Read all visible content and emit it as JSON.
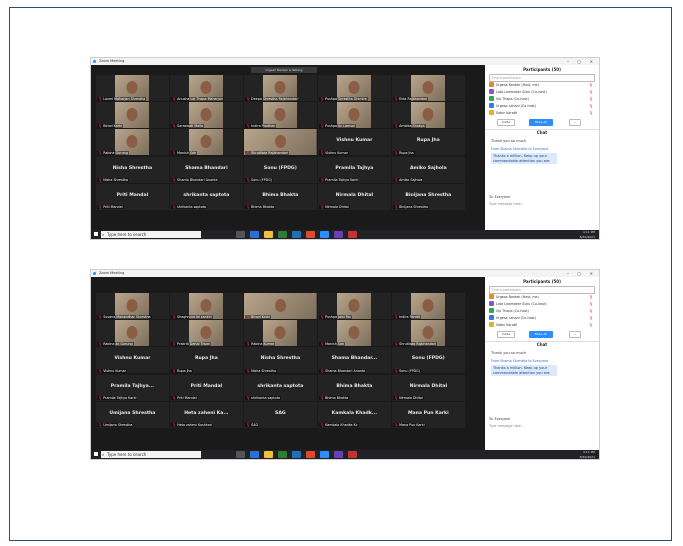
{
  "shot1": {
    "title": "Zoom Meeting",
    "notice": "Urgesh Bardah is Talking",
    "tiles": [
      {
        "name": "Laxmi Maharjan Shrestha",
        "video": true
      },
      {
        "name": "Anusha Lal Thapa Maharjan",
        "video": true
      },
      {
        "name": "Deepa Shrestha Rajbhandari",
        "video": true
      },
      {
        "name": "Pushpa Shrestha Ghimire",
        "video": true
      },
      {
        "name": "Ekta Rajbhandari",
        "video": true
      },
      {
        "name": "Binod Karki",
        "video": true
      },
      {
        "name": "Saraswati Malla",
        "video": true
      },
      {
        "name": "Indira Pradhan",
        "video": true
      },
      {
        "name": "Pushpa Kc Lamsal",
        "video": true
      },
      {
        "name": "Ambika Shakya",
        "video": true
      },
      {
        "name": "Rabina Gurung",
        "video": true
      },
      {
        "name": "Manish Sah",
        "video": true
      },
      {
        "name": "Shrutilata Rajbhandari",
        "video": true,
        "wide": true
      },
      {
        "name": "Vishnu Kumar",
        "video": false,
        "label": "Vishnu Kumar"
      },
      {
        "name": "Rupa Jha",
        "video": false,
        "label": "Rupa Jha"
      },
      {
        "name": "Nisha Shrestha",
        "video": false,
        "label": "Nisha Shrestha"
      },
      {
        "name": "Shanta Bhandari Ananta",
        "video": false,
        "label": "Shama Bhandari"
      },
      {
        "name": "Sonu (FPDG)",
        "video": false,
        "label": "Sonu (FPDG)"
      },
      {
        "name": "Pramila Tajhya Karki",
        "video": false,
        "label": "Pramila Tajhya"
      },
      {
        "name": "Amiko Sajhola",
        "video": false,
        "label": "Amiko Sajhola"
      },
      {
        "name": "Priti Mandal",
        "video": false,
        "label": "Priti Mandal"
      },
      {
        "name": "shrikanta saptota",
        "video": false,
        "label": "shrikanta saptota"
      },
      {
        "name": "Bhima Bhakta",
        "video": false,
        "label": "Bhima Bhakta"
      },
      {
        "name": "Nirmala Dhital",
        "video": false,
        "label": "Nirmala Dhital"
      },
      {
        "name": "Binijana Shrestha",
        "video": false,
        "label": "Binijana Shrestha"
      }
    ],
    "participants_title": "Participants (50)",
    "search_placeholder": "Find a participant",
    "participants": [
      {
        "name": "Urgesa Bardah (Host, me)",
        "color": "#e58a2b"
      },
      {
        "name": "Lata Lawmaker Suku (Co-host)",
        "color": "#8a57c7"
      },
      {
        "name": "Vip Thapa (Co-host)",
        "color": "#2fa84f"
      },
      {
        "name": "Urgesa Lahani (Co-host)",
        "color": "#3b7be0"
      },
      {
        "name": "Sabin Karatti",
        "color": "#e0b02f"
      }
    ],
    "btn_invite": "Invite",
    "btn_mute_all": "Mute All",
    "btn_more": "...",
    "chat_title": "Chat",
    "chat_msg": "Thank you so much",
    "chat_from": "From Shama Shrestha to Everyone",
    "chat_bubble": "Thanks a million. Keep up your commendable attention you are.",
    "chat_to": "To: Everyone",
    "chat_placeholder": "Type message here...",
    "search_text": "Type here to search",
    "tray_time": "4:11 PM",
    "tray_date": "8/30/2021"
  },
  "shot2": {
    "title": "Zoom Meeting",
    "tiles": [
      {
        "name": "Susana Manandhar Shrestha",
        "video": true
      },
      {
        "name": "Shaghruva lal sankhi",
        "video": true
      },
      {
        "name": "Binod Karki",
        "video": true,
        "wide": true
      },
      {
        "name": "Pushpa Jaisi Rai",
        "video": true
      },
      {
        "name": "Indira Pandit",
        "video": true
      },
      {
        "name": "Rabina kc Gurung",
        "video": true
      },
      {
        "name": "Prakriti Dahal Tiwari",
        "video": true
      },
      {
        "name": "Rabina Kumar",
        "video": true
      },
      {
        "name": "Manish Sah",
        "video": true
      },
      {
        "name": "Shrutilata Rajbhandari",
        "video": true
      },
      {
        "name": "Vishnu Kumar",
        "video": false,
        "label": "Vishnu Kumar"
      },
      {
        "name": "Rupa Jha",
        "video": false,
        "label": "Rupa Jha"
      },
      {
        "name": "Nisha Shrestha",
        "video": false,
        "label": "Nisha Shrestha"
      },
      {
        "name": "Shama Bhandari Ananta",
        "video": false,
        "label": "Shama Bhandar..."
      },
      {
        "name": "Sonu (FPDG)",
        "video": false,
        "label": "Sonu (FPDG)"
      },
      {
        "name": "Pramila Tajhya Karki",
        "video": false,
        "label": "Pramila Tajhya..."
      },
      {
        "name": "Priti Mandal",
        "video": false,
        "label": "Priti Mandal"
      },
      {
        "name": "shrikanta saptota",
        "video": false,
        "label": "shrikanta saptota"
      },
      {
        "name": "Bhima Bhakta",
        "video": false,
        "label": "Bhima Bhakta"
      },
      {
        "name": "Nirmala Dhital",
        "video": false,
        "label": "Nirmala Dhital"
      },
      {
        "name": "Umijana Shrestha",
        "video": false,
        "label": "Umijana Shrestha"
      },
      {
        "name": "Heta zaheni Kushkari",
        "video": false,
        "label": "Heta zaheni Ka..."
      },
      {
        "name": "SAG",
        "video": false,
        "label": "SAG"
      },
      {
        "name": "Kamkala Khadka Kc",
        "video": false,
        "label": "Kamkala Khadk..."
      },
      {
        "name": "Mana Pun Karki",
        "video": false,
        "label": "Mana Pun Karki"
      }
    ],
    "participants_title": "Participants (50)",
    "search_placeholder": "Find a participant",
    "participants": [
      {
        "name": "Urgesa Bardah (Host, me)",
        "color": "#e58a2b"
      },
      {
        "name": "Lata Lawmaker Suku (Co-host)",
        "color": "#8a57c7"
      },
      {
        "name": "Vip Thapa (Co-host)",
        "color": "#2fa84f"
      },
      {
        "name": "Urgesa Lahani (Co-host)",
        "color": "#3b7be0"
      },
      {
        "name": "Sabin Karatti",
        "color": "#e0b02f"
      }
    ],
    "btn_invite": "Invite",
    "btn_mute_all": "Mute All",
    "btn_more": "...",
    "chat_title": "Chat",
    "chat_msg": "Thank you so much",
    "chat_from": "From Shama Shrestha to Everyone",
    "chat_bubble": "Thanks a million. Keep up your commendable attention you are.",
    "chat_to": "To: Everyone",
    "chat_placeholder": "Type message here...",
    "search_text": "Type here to search",
    "tray_time": "4:11 PM",
    "tray_date": "8/30/2021"
  }
}
